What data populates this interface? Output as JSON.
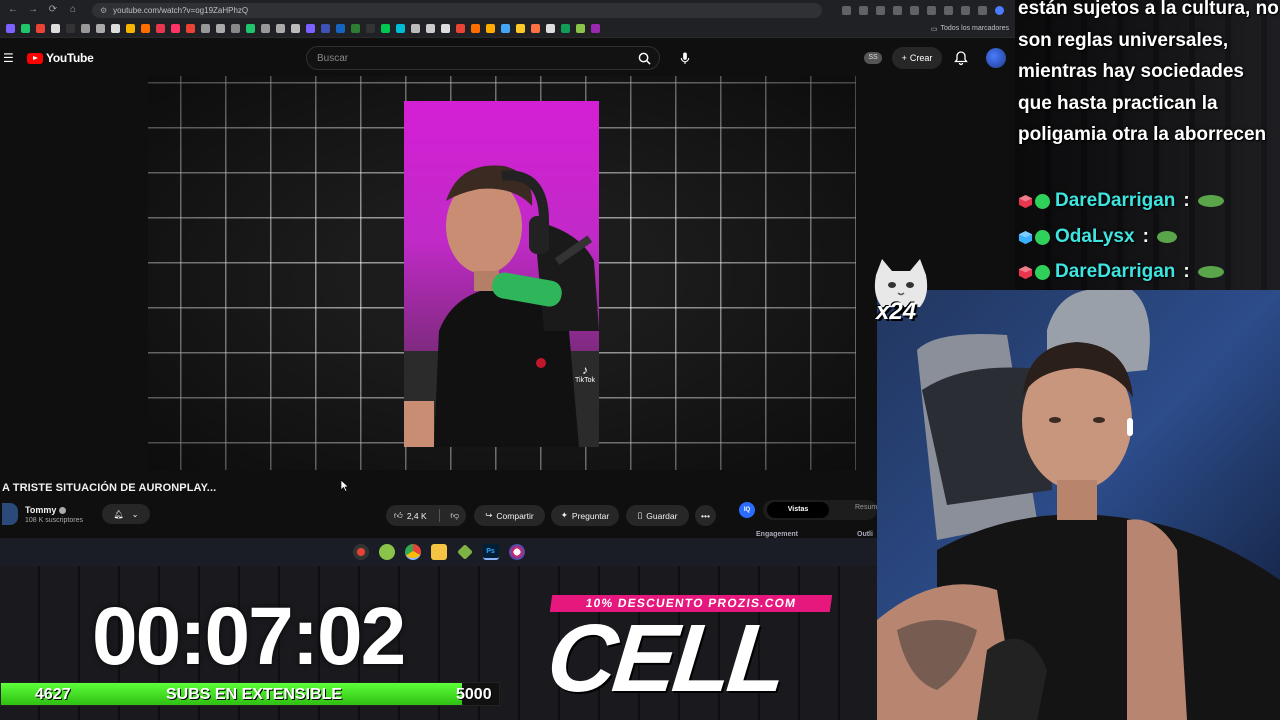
{
  "browser": {
    "url": "youtube.com/watch?v=og19ZaHPhzQ",
    "bookmarks_folder": "Todos los marcadores"
  },
  "youtube": {
    "logo_text": "YouTube",
    "search_placeholder": "Buscar",
    "ss_badge": "SS",
    "create_label": "Crear",
    "video_title": "A TRISTE SITUACIÓN DE AURONPLAY...",
    "tiktok_label": "TikTok",
    "channel": {
      "name": "Tommy",
      "subscribers": "108 K suscriptores"
    },
    "actions": {
      "likes": "2,4 K",
      "share": "Compartir",
      "ask": "Preguntar",
      "save": "Guardar"
    },
    "side_panel": {
      "iq": "IQ",
      "active_tab": "Vistas",
      "other_tab": "Resum",
      "label_left": "Engagement",
      "label_right": "Outli"
    }
  },
  "taskbar": {
    "apps": [
      "record-app",
      "chat-app",
      "chrome",
      "file-explorer",
      "minecraft",
      "photoshop",
      "paint"
    ],
    "ps_label": "Ps"
  },
  "chat": {
    "message": "están sujetos a la cultura, no son reglas universales, mientras hay sociedades que hasta practican la poligamia otra la aborrecen",
    "lines": [
      {
        "user": "DareDarrigan",
        "sep": ":",
        "cube_color": "#e8364f"
      },
      {
        "user": "OdaLysx",
        "sep": ":",
        "cube_color": "#3ab0ff"
      },
      {
        "user": "DareDarrigan",
        "sep": ":",
        "cube_color": "#e8364f"
      }
    ],
    "emote_count": "x24"
  },
  "stream": {
    "timer": "00:07:02",
    "subs_current": "4627",
    "subs_label": "SUBS EN EXTENSIBLE",
    "subs_goal": "5000",
    "subs_progress": 0.9254,
    "promo_line": "10% DESCUENTO PROZIS.COM",
    "promo_big": "CELL"
  },
  "colors": {
    "youtube_red": "#ff0000",
    "chat_user": "#3ee5e0",
    "subs_fill": "#4fe82a",
    "promo_pink": "#e6177d"
  }
}
